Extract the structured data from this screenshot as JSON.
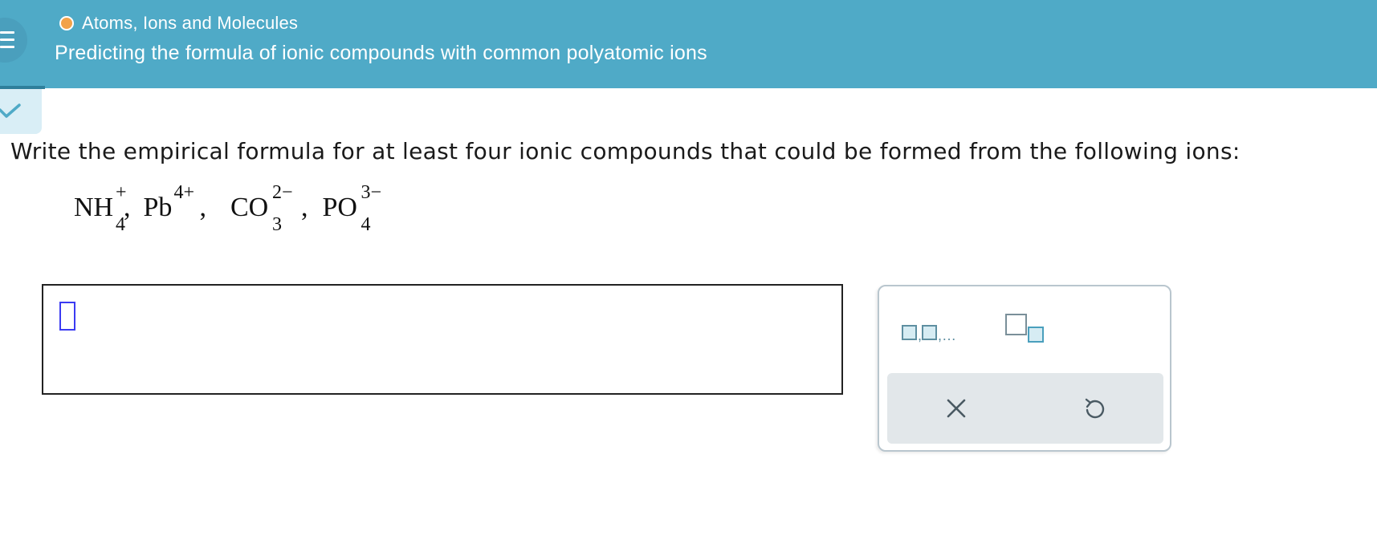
{
  "header": {
    "topic": "Atoms, Ions and Molecules",
    "title": "Predicting the formula of ionic compounds with common polyatomic ions"
  },
  "question": {
    "prompt": "Write the empirical formula for at least four ionic compounds that could be formed from the following ions:",
    "ions": [
      {
        "base": "NH",
        "sub": "4",
        "sup": "+"
      },
      {
        "base": "Pb",
        "sub": "",
        "sup": "4+"
      },
      {
        "base": "CO",
        "sub": "3",
        "sup": "2−"
      },
      {
        "base": "PO",
        "sub": "4",
        "sup": "3−"
      }
    ],
    "separator": ","
  },
  "tools": {
    "list_ellipsis": ",…",
    "list_comma": ","
  },
  "colors": {
    "header": "#4faac7",
    "topic_dot": "#f2a24a",
    "cursor": "#3b3bf2",
    "action_bar": "#e2e7ea"
  },
  "icons": [
    "menu-icon",
    "checkmark-icon",
    "list-template-icon",
    "subscript-template-icon",
    "clear-icon",
    "undo-icon"
  ]
}
